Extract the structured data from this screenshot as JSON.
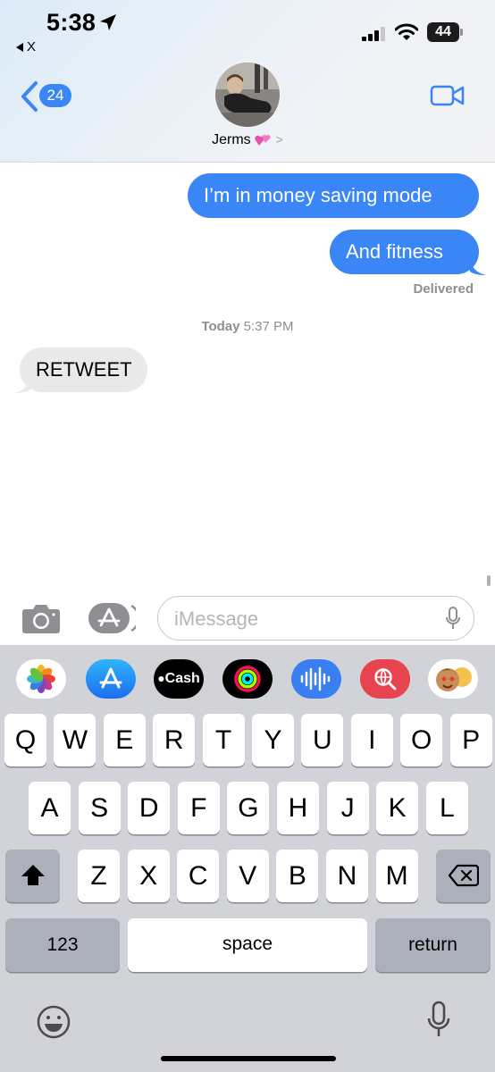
{
  "status_bar": {
    "time": "5:38",
    "back_app": "X",
    "battery": "44"
  },
  "header": {
    "back_count": "24",
    "contact_name": "Jerms",
    "chevron": ">"
  },
  "messages": [
    {
      "direction": "outgoing",
      "text": "I’m in money saving mode"
    },
    {
      "direction": "outgoing",
      "text": "And fitness"
    },
    {
      "direction": "incoming",
      "text": "RETWEET"
    }
  ],
  "delivery_status": "Delivered",
  "timestamp": {
    "day": "Today",
    "time": "5:37 PM"
  },
  "input": {
    "placeholder": "iMessage"
  },
  "app_drawer": {
    "items": [
      "photos-icon",
      "app-store-icon",
      "apple-cash-icon",
      "activity-icon",
      "audio-message-icon",
      "image-search-icon",
      "memoji-icon"
    ],
    "cash_label": "Cash"
  },
  "keyboard": {
    "row1": [
      "Q",
      "W",
      "E",
      "R",
      "T",
      "Y",
      "U",
      "I",
      "O",
      "P"
    ],
    "row2": [
      "A",
      "S",
      "D",
      "F",
      "G",
      "H",
      "J",
      "K",
      "L"
    ],
    "row3": [
      "Z",
      "X",
      "C",
      "V",
      "B",
      "N",
      "M"
    ],
    "numbers_label": "123",
    "space_label": "space",
    "return_label": "return"
  },
  "colors": {
    "outgoing_bubble": "#3a86f7",
    "incoming_bubble": "#e9e9eb",
    "keyboard_bg": "#d1d3d9"
  }
}
